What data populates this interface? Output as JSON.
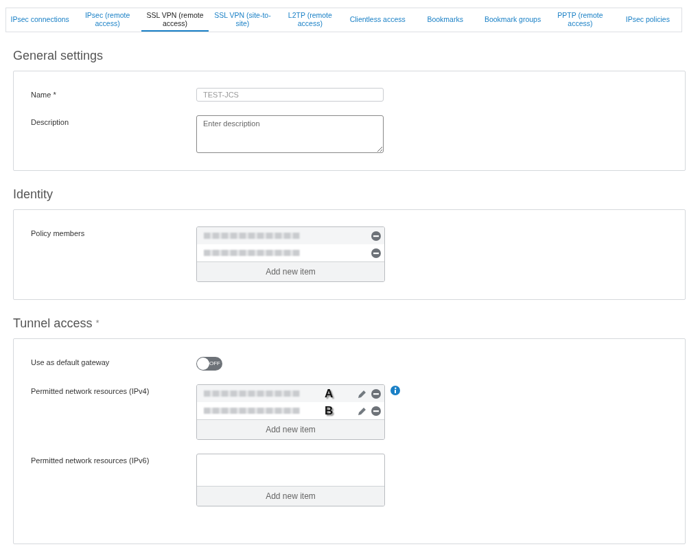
{
  "tabs": [
    {
      "label": "IPsec connections",
      "selected": false
    },
    {
      "label": "IPsec (remote access)",
      "selected": false
    },
    {
      "label": "SSL VPN (remote access)",
      "selected": true
    },
    {
      "label": "SSL VPN (site-to-site)",
      "selected": false
    },
    {
      "label": "L2TP (remote access)",
      "selected": false
    },
    {
      "label": "Clientless access",
      "selected": false
    },
    {
      "label": "Bookmarks",
      "selected": false
    },
    {
      "label": "Bookmark groups",
      "selected": false
    },
    {
      "label": "PPTP (remote access)",
      "selected": false
    },
    {
      "label": "IPsec policies",
      "selected": false
    }
  ],
  "sections": [
    {
      "title": "General settings",
      "fields": [
        {
          "kind": "text",
          "label": "Name",
          "required_mark": "*",
          "value": "TEST-JCS"
        },
        {
          "kind": "textarea",
          "label": "Description",
          "placeholder": "Enter description"
        }
      ]
    },
    {
      "title": "Identity",
      "fields": [
        {
          "kind": "list",
          "label": "Policy members",
          "items": [
            {
              "editable": false
            },
            {
              "editable": false
            }
          ],
          "add_label": "Add new item"
        }
      ]
    },
    {
      "title": "Tunnel access",
      "required_mark": "*",
      "fields": [
        {
          "kind": "toggle",
          "label": "Use as default gateway",
          "on": false,
          "state_label": "OFF"
        },
        {
          "kind": "list",
          "label": "Permitted network resources (IPv4)",
          "info": true,
          "items": [
            {
              "editable": true,
              "annotation": "A"
            },
            {
              "editable": true,
              "annotation": "B"
            }
          ],
          "add_label": "Add new item"
        },
        {
          "kind": "list",
          "label": "Permitted network resources (IPv6)",
          "add_label": "Add new item"
        }
      ]
    }
  ]
}
